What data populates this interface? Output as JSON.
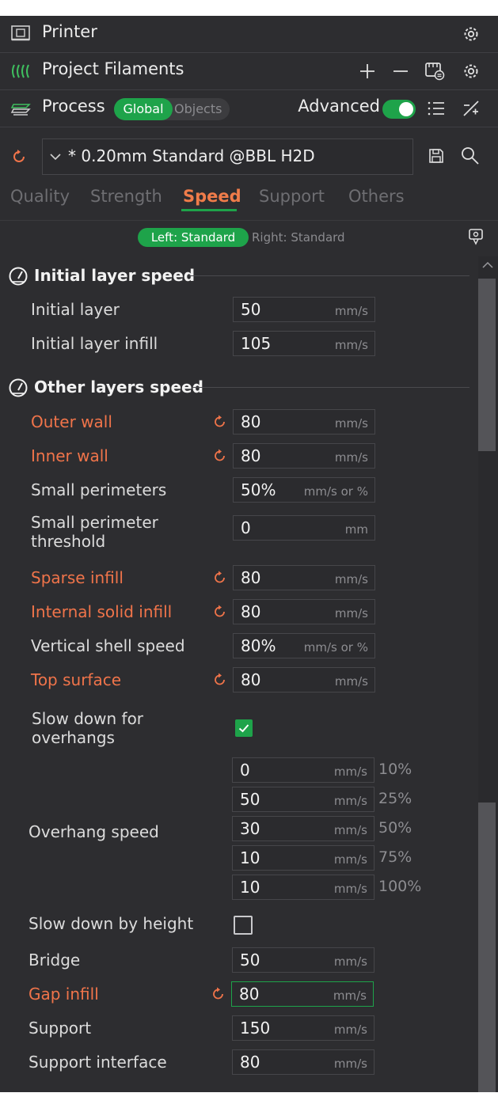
{
  "header": {
    "printer_label": "Printer",
    "filaments_label": "Project Filaments",
    "process_label": "Process",
    "scope_global": "Global",
    "scope_objects": "Objects",
    "advanced_label": "Advanced",
    "advanced_on": true
  },
  "preset": {
    "name": "* 0.20mm Standard @BBL H2D"
  },
  "tabs": [
    "Quality",
    "Strength",
    "Speed",
    "Support",
    "Others"
  ],
  "active_tab": "Speed",
  "compare": {
    "left": "Left: Standard",
    "right": "Right: Standard"
  },
  "sections": {
    "initial": "Initial layer speed",
    "other": "Other layers speed"
  },
  "initial_rows": [
    {
      "label": "Initial layer",
      "value": "50",
      "unit": "mm/s"
    },
    {
      "label": "Initial layer infill",
      "value": "105",
      "unit": "mm/s"
    }
  ],
  "rows": {
    "outer_wall": {
      "label": "Outer wall",
      "value": "80",
      "unit": "mm/s"
    },
    "inner_wall": {
      "label": "Inner wall",
      "value": "80",
      "unit": "mm/s"
    },
    "small_perimeters": {
      "label": "Small perimeters",
      "value": "50%",
      "unit": "mm/s or %"
    },
    "small_perimeter_threshold": {
      "label_line1": "Small perimeter",
      "label_line2": "threshold",
      "value": "0",
      "unit": "mm"
    },
    "sparse_infill": {
      "label": "Sparse infill",
      "value": "80",
      "unit": "mm/s"
    },
    "internal_solid_infill": {
      "label": "Internal solid infill",
      "value": "80",
      "unit": "mm/s"
    },
    "vertical_shell_speed": {
      "label": "Vertical shell speed",
      "value": "80%",
      "unit": "mm/s or %"
    },
    "top_surface": {
      "label": "Top surface",
      "value": "80",
      "unit": "mm/s"
    },
    "slow_overhangs": {
      "label_line1": "Slow down for",
      "label_line2": "overhangs",
      "checked": true
    },
    "overhang_speed": {
      "label": "Overhang speed",
      "entries": [
        {
          "value": "0",
          "unit": "mm/s",
          "pct": "10%"
        },
        {
          "value": "50",
          "unit": "mm/s",
          "pct": "25%"
        },
        {
          "value": "30",
          "unit": "mm/s",
          "pct": "50%"
        },
        {
          "value": "10",
          "unit": "mm/s",
          "pct": "75%"
        },
        {
          "value": "10",
          "unit": "mm/s",
          "pct": "100%"
        }
      ]
    },
    "slow_by_height": {
      "label": "Slow down by height",
      "checked": false
    },
    "bridge": {
      "label": "Bridge",
      "value": "50",
      "unit": "mm/s"
    },
    "gap_infill": {
      "label": "Gap infill",
      "value": "80",
      "unit": "mm/s"
    },
    "support": {
      "label": "Support",
      "value": "150",
      "unit": "mm/s"
    },
    "support_interface": {
      "label": "Support interface",
      "value": "80",
      "unit": "mm/s"
    }
  },
  "colors": {
    "accent": "#1ea34a",
    "modified": "#f0744a",
    "panel": "#2d2d30"
  }
}
